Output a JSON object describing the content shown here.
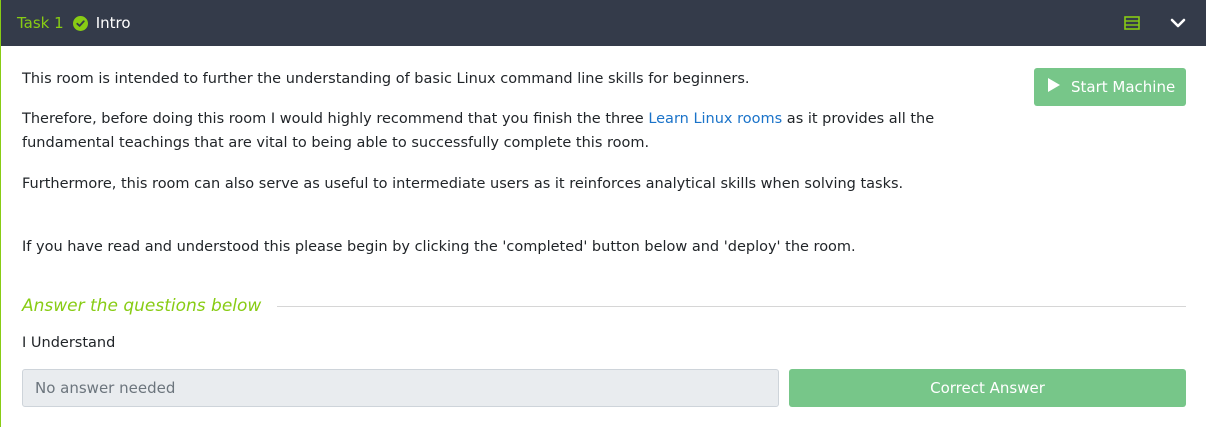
{
  "task": {
    "number": "Task 1",
    "title": "Intro",
    "accent_color": "#88cc14",
    "header_bg": "#343b4a",
    "icons": [
      "check-circle-icon",
      "menu-lines-icon",
      "chevron-down-icon"
    ]
  },
  "start_machine": {
    "label": "Start Machine",
    "icon": "play-icon",
    "color": "#77c689"
  },
  "content": {
    "para1": "This room is intended to further the understanding of basic Linux command line skills for beginners.",
    "para2_before": "Therefore, before doing this room I would highly recommend that you finish the three ",
    "para2_link": "Learn Linux rooms",
    "para2_after": " as it provides all the",
    "para2_line2": "fundamental teachings that are vital to being able to successfully complete this room.",
    "para3": "Furthermore, this room can also serve as useful to intermediate users as it reinforces analytical skills when solving tasks.",
    "para4": "If you have read and understood this please begin by clicking the 'completed' button below and 'deploy' the room."
  },
  "questions": {
    "heading": "Answer the questions below",
    "items": [
      {
        "question": "I Understand",
        "placeholder": "No answer needed",
        "button_label": "Correct Answer"
      }
    ]
  }
}
